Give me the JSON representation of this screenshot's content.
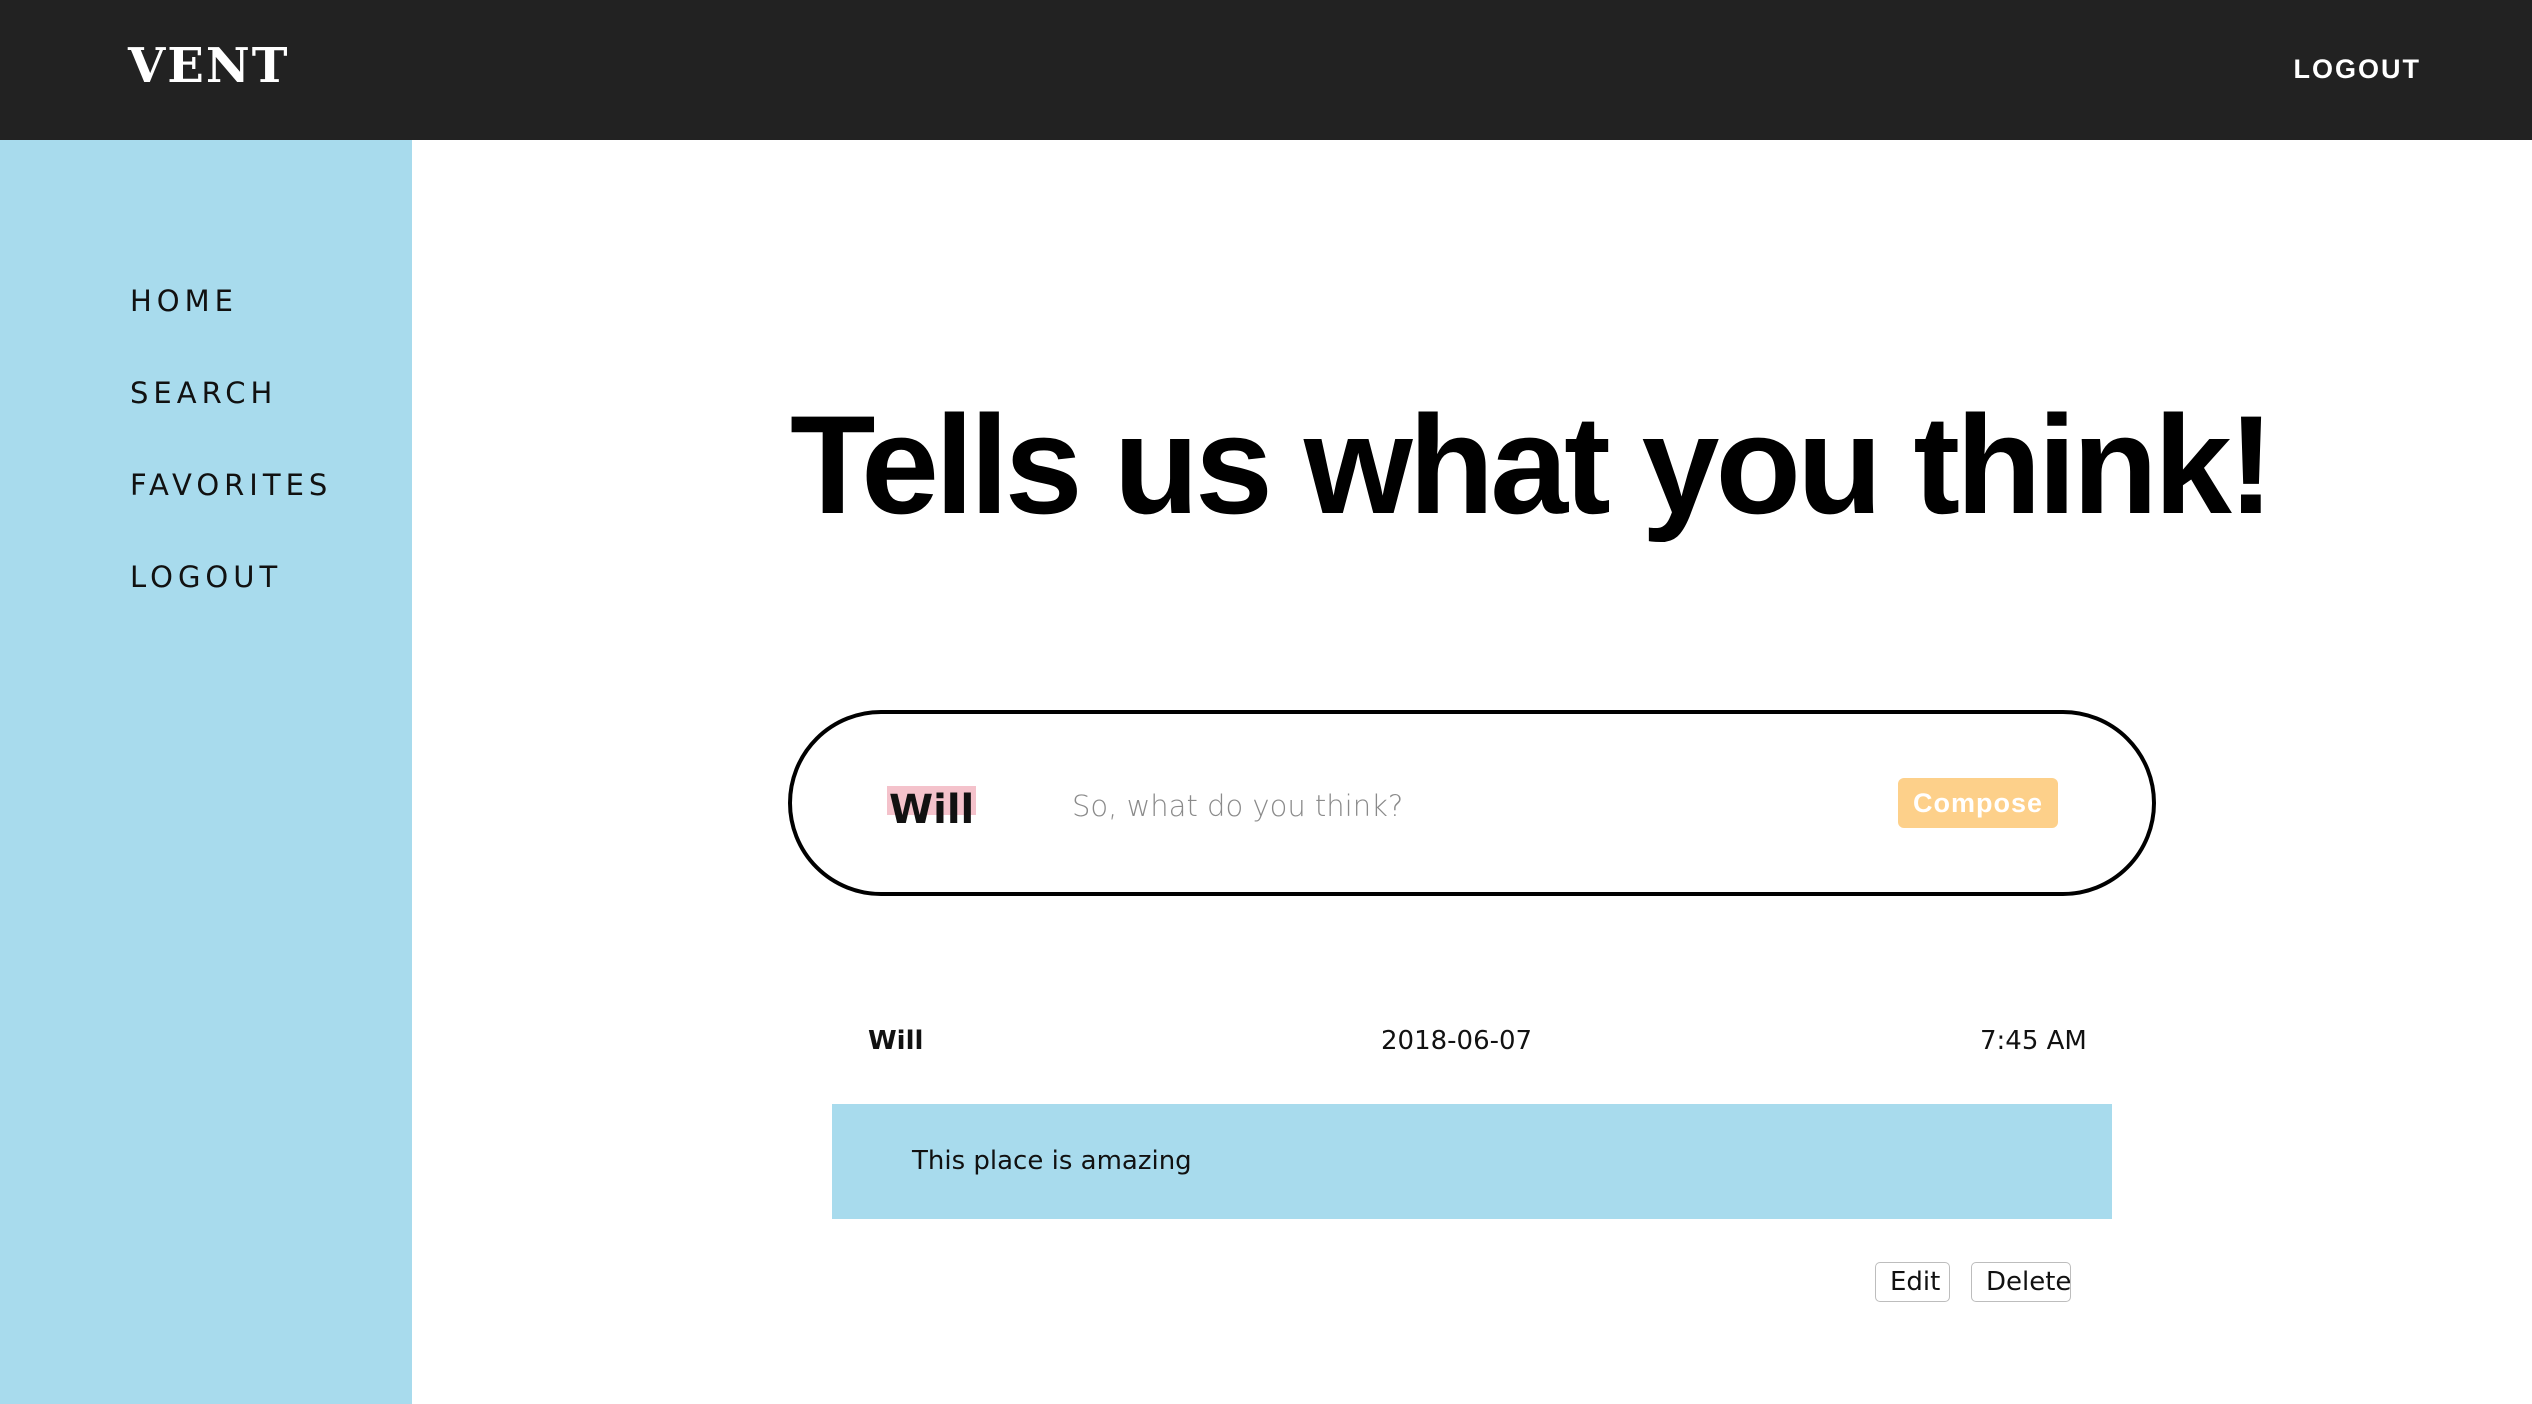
{
  "header": {
    "brand": "VENT",
    "logout_label": "LOGOUT"
  },
  "sidebar": {
    "items": [
      {
        "label": "HOME"
      },
      {
        "label": "SEARCH"
      },
      {
        "label": "FAVORITES"
      },
      {
        "label": "LOGOUT"
      }
    ]
  },
  "main": {
    "headline": "Tells us what you think!",
    "compose": {
      "username": "Will",
      "placeholder": "So, what do you think?",
      "button_label": "Compose"
    },
    "posts": [
      {
        "username": "Will",
        "date": "2018-06-07",
        "time": "7:45 AM",
        "body": "This place is amazing",
        "edit_label": "Edit",
        "delete_label": "Delete"
      }
    ]
  },
  "colors": {
    "header_bg": "#222222",
    "sidebar_bg": "#a8dbed",
    "compose_button": "#fdd08a",
    "username_highlight": "#f4c2cb"
  }
}
